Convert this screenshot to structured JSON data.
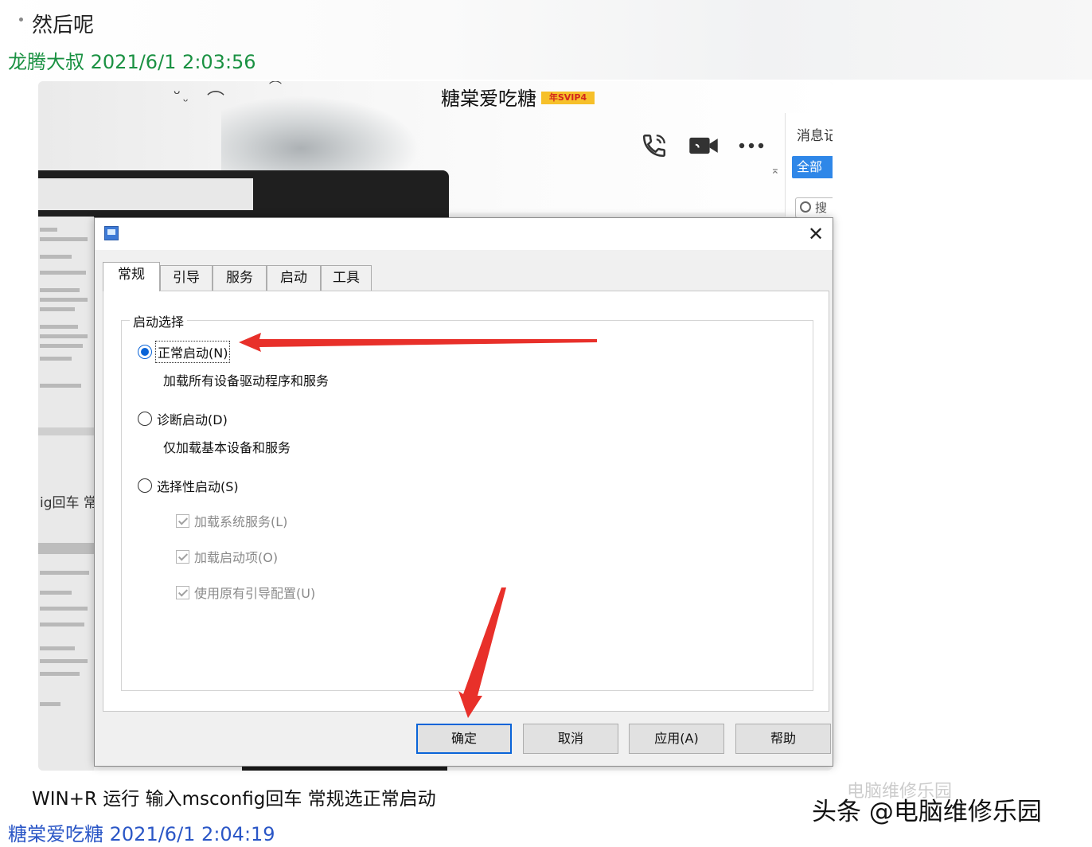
{
  "chat": {
    "prev_message": "然后呢",
    "sender1": {
      "name": "龙腾大叔",
      "time": "2021/6/1 2:03:56",
      "color": "#1a9142"
    },
    "caption": "WIN+R 运行 输入msconfig回车 常规选正常启动",
    "sender2": {
      "name": "糖棠爱吃糖",
      "time": "2021/6/1 2:04:19",
      "color": "#2a56c6"
    }
  },
  "qq": {
    "contact_name": "糖棠爱吃糖",
    "vip_badge": "年SVIP4",
    "icons": [
      "phone-icon",
      "video-camera-icon",
      "more-icon"
    ],
    "side_title": "消息记",
    "side_filter": "全部",
    "side_search": "搜",
    "bg_text": "ig回车 常"
  },
  "dialog": {
    "tabs": [
      "常规",
      "引导",
      "服务",
      "启动",
      "工具"
    ],
    "active_tab": "常规",
    "group_title": "启动选择",
    "options": [
      {
        "label": "正常启动(N)",
        "desc": "加载所有设备驱动程序和服务",
        "checked": true
      },
      {
        "label": "诊断启动(D)",
        "desc": "仅加载基本设备和服务",
        "checked": false
      },
      {
        "label": "选择性启动(S)",
        "desc": "",
        "checked": false
      }
    ],
    "sub_options": [
      "加载系统服务(L)",
      "加载启动项(O)",
      "使用原有引导配置(U)"
    ],
    "buttons": {
      "ok": "确定",
      "cancel": "取消",
      "apply": "应用(A)",
      "help": "帮助"
    },
    "close": "✕",
    "accent": "#0a64d8"
  },
  "watermark": {
    "text": "头条 @电脑维修乐园",
    "ghost": "电脑维修乐园"
  },
  "annotation_color": "#e8302a"
}
